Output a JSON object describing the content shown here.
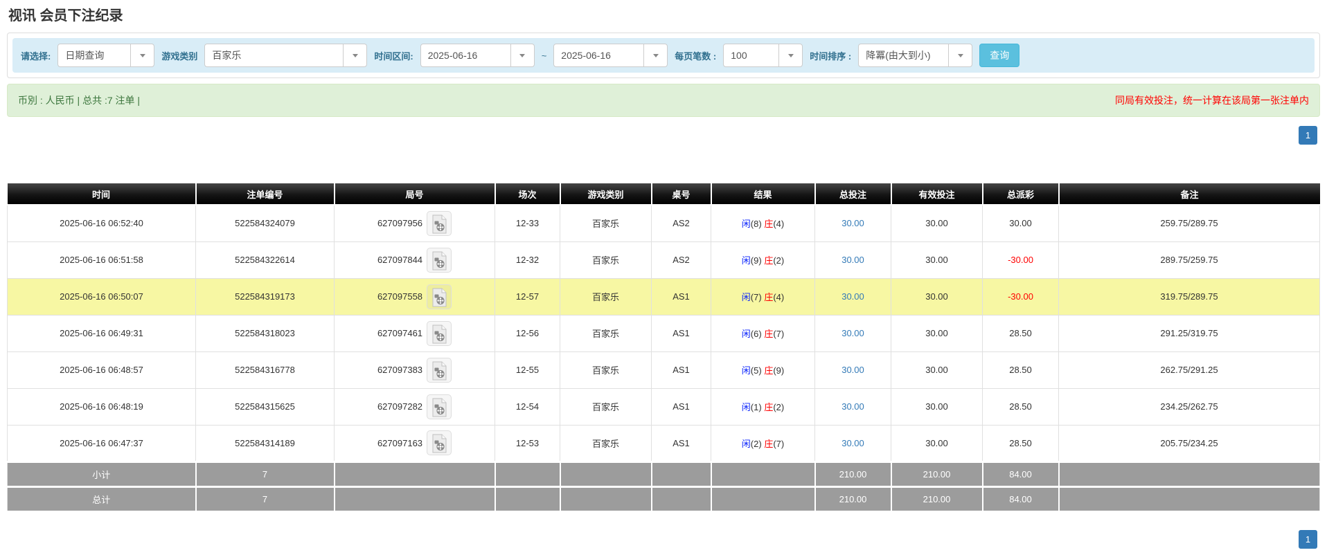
{
  "page_title": "视讯 会员下注纪录",
  "filter_bar": {
    "query_type_label": "请选择:",
    "query_type_value": "日期查询",
    "game_category_label": "游戏类别",
    "game_category_value": "百家乐",
    "time_range_label": "时间区间:",
    "date_from": "2025-06-16",
    "range_separator": "~",
    "date_to": "2025-06-16",
    "page_size_label": "每页笔数 :",
    "page_size_value": "100",
    "time_sort_label": "时间排序 :",
    "time_sort_value": "降冪(由大到小)",
    "search_button_label": "查询"
  },
  "info_bar": {
    "summary_text": "币別 : 人民币 | 总共 :7 注单 |",
    "notice_text": "同局有效投注，统一计算在该局第一张注单内"
  },
  "pagination": {
    "current_page": "1"
  },
  "table": {
    "headers": [
      "时间",
      "注单编号",
      "局号",
      "场次",
      "游戏类别",
      "桌号",
      "结果",
      "总投注",
      "有效投注",
      "总派彩",
      "备注"
    ],
    "result_labels": {
      "player": "闲",
      "banker": "庄"
    },
    "icons": {
      "round_icon": "video-film-icon"
    },
    "rows": [
      {
        "time": "2025-06-16 06:52:40",
        "bet_id": "522584324079",
        "round_id": "627097956",
        "session": "12-33",
        "game": "百家乐",
        "table_no": "AS2",
        "player_score": "8",
        "banker_score": "4",
        "total_bet": "30.00",
        "valid_bet": "30.00",
        "total_payout": "30.00",
        "note": "259.75/289.75",
        "highlight": false
      },
      {
        "time": "2025-06-16 06:51:58",
        "bet_id": "522584322614",
        "round_id": "627097844",
        "session": "12-32",
        "game": "百家乐",
        "table_no": "AS2",
        "player_score": "9",
        "banker_score": "2",
        "total_bet": "30.00",
        "valid_bet": "30.00",
        "total_payout": "-30.00",
        "note": "289.75/259.75",
        "highlight": false
      },
      {
        "time": "2025-06-16 06:50:07",
        "bet_id": "522584319173",
        "round_id": "627097558",
        "session": "12-57",
        "game": "百家乐",
        "table_no": "AS1",
        "player_score": "7",
        "banker_score": "4",
        "total_bet": "30.00",
        "valid_bet": "30.00",
        "total_payout": "-30.00",
        "note": "319.75/289.75",
        "highlight": true
      },
      {
        "time": "2025-06-16 06:49:31",
        "bet_id": "522584318023",
        "round_id": "627097461",
        "session": "12-56",
        "game": "百家乐",
        "table_no": "AS1",
        "player_score": "6",
        "banker_score": "7",
        "total_bet": "30.00",
        "valid_bet": "30.00",
        "total_payout": "28.50",
        "note": "291.25/319.75",
        "highlight": false
      },
      {
        "time": "2025-06-16 06:48:57",
        "bet_id": "522584316778",
        "round_id": "627097383",
        "session": "12-55",
        "game": "百家乐",
        "table_no": "AS1",
        "player_score": "5",
        "banker_score": "9",
        "total_bet": "30.00",
        "valid_bet": "30.00",
        "total_payout": "28.50",
        "note": "262.75/291.25",
        "highlight": false
      },
      {
        "time": "2025-06-16 06:48:19",
        "bet_id": "522584315625",
        "round_id": "627097282",
        "session": "12-54",
        "game": "百家乐",
        "table_no": "AS1",
        "player_score": "1",
        "banker_score": "2",
        "total_bet": "30.00",
        "valid_bet": "30.00",
        "total_payout": "28.50",
        "note": "234.25/262.75",
        "highlight": false
      },
      {
        "time": "2025-06-16 06:47:37",
        "bet_id": "522584314189",
        "round_id": "627097163",
        "session": "12-53",
        "game": "百家乐",
        "table_no": "AS1",
        "player_score": "2",
        "banker_score": "7",
        "total_bet": "30.00",
        "valid_bet": "30.00",
        "total_payout": "28.50",
        "note": "205.75/234.25",
        "highlight": false
      }
    ],
    "summary_rows": [
      {
        "label": "小计",
        "count": "7",
        "total_bet": "210.00",
        "valid_bet": "210.00",
        "total_payout": "84.00"
      },
      {
        "label": "总计",
        "count": "7",
        "total_bet": "210.00",
        "valid_bet": "210.00",
        "total_payout": "84.00"
      }
    ]
  },
  "colors": {
    "filter_bar_bg": "#d9edf7",
    "filter_label": "#31708f",
    "search_button_bg": "#5bc0de",
    "info_bar_bg": "#dff0d8",
    "info_text_green": "#3c763d",
    "notice_red": "#ff0000",
    "header_bg": "#000000",
    "highlight_row": "#f7f7a3",
    "summary_row_bg": "#9c9c9c",
    "link_blue": "#337ab7",
    "player_blue": "#0b24fb",
    "banker_red": "#ff0000",
    "pager_blue": "#337ab7"
  }
}
